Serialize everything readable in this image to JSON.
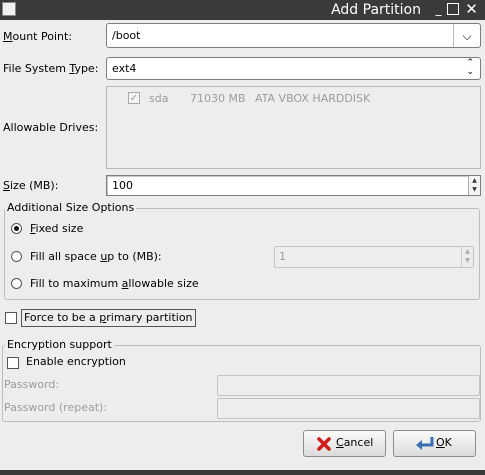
{
  "window": {
    "title": "Add Partition",
    "close_glyph": "✕"
  },
  "mount_point": {
    "label": "Mount Point:",
    "value": "/boot"
  },
  "filesystem_type": {
    "label": "File System Type:",
    "value": "ext4"
  },
  "allowable_drives": {
    "label": "Allowable Drives:",
    "drives": [
      {
        "name": "sda",
        "size": "71030 MB",
        "model": "ATA VBOX HARDDISK",
        "checked": true
      }
    ]
  },
  "size": {
    "label": "Size (MB):",
    "value": "100"
  },
  "additional_size_options": {
    "title": "Additional Size Options",
    "fixed_size": "Fixed size",
    "fill_up_to": "Fill all space up to (MB):",
    "fill_up_to_value": "1",
    "fill_max": "Fill to maximum allowable size"
  },
  "primary_partition": {
    "label": "Force to be a primary partition"
  },
  "encryption": {
    "title": "Encryption support",
    "enable_label": "Enable encryption",
    "password_label": "Password:",
    "password_repeat_label": "Password (repeat):"
  },
  "buttons": {
    "cancel": "Cancel",
    "ok": "OK"
  },
  "colors": {
    "titlebar": "#3a3a3a",
    "background": "#ededed",
    "cancel_icon": "#d11c1c"
  }
}
